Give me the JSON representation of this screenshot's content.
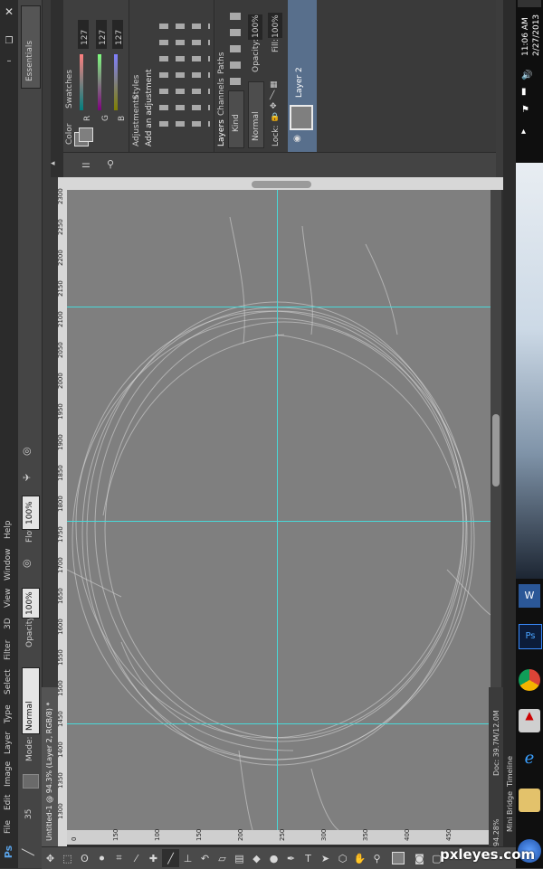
{
  "menubar": {
    "app_logo": "Ps",
    "items": [
      "File",
      "Edit",
      "Image",
      "Layer",
      "Type",
      "Select",
      "Filter",
      "3D",
      "View",
      "Window",
      "Help"
    ]
  },
  "options_bar": {
    "brush_size": "35",
    "mode_label": "Mode:",
    "mode_value": "Normal",
    "opacity_label": "Opacity:",
    "opacity_value": "100%",
    "flow_label": "Flow:",
    "flow_value": "100%",
    "workspace": "Essentials"
  },
  "document": {
    "tab_title": "Untitled-1 @ 94.3% (Layer 2, RGB/8) *",
    "zoom": "94.28%",
    "doc_size": "Doc: 39.7M/12.0M",
    "ruler_marks": [
      "1300",
      "1350",
      "1400",
      "1450",
      "1500",
      "1550",
      "1600",
      "1650",
      "1700",
      "1750",
      "1800",
      "1850",
      "1900",
      "1950",
      "2000",
      "2050",
      "2100",
      "2150",
      "2200",
      "2250",
      "2300"
    ],
    "side_ruler_marks": [
      "0",
      "150",
      "100",
      "150",
      "200",
      "250",
      "300",
      "350",
      "400",
      "450"
    ]
  },
  "panels": {
    "color_tabs": [
      "Color",
      "Swatches"
    ],
    "rgb": [
      {
        "label": "R",
        "value": "127"
      },
      {
        "label": "G",
        "value": "127"
      },
      {
        "label": "B",
        "value": "127"
      }
    ],
    "adjustments_tabs": [
      "Adjustments",
      "Styles"
    ],
    "adjustments_title": "Add an adjustment",
    "layers_tabs": [
      "Layers",
      "Channels",
      "Paths"
    ],
    "kind_label": "Kind",
    "blend_mode": "Normal",
    "opacity_label": "Opacity:",
    "opacity_value": "100%",
    "lock_label": "Lock:",
    "fill_label": "Fill:",
    "fill_value": "100%",
    "layer_name": "Layer 2"
  },
  "bottom_tabs": [
    "Mini Bridge",
    "Timeline"
  ],
  "taskbar": {
    "time": "11:06 AM",
    "date": "2/27/2013"
  },
  "watermark": "pxleyes.com",
  "colors": {
    "guide": "#49d9d9",
    "canvas": "#7f7f7f",
    "ui_dark": "#3a3a3a"
  }
}
